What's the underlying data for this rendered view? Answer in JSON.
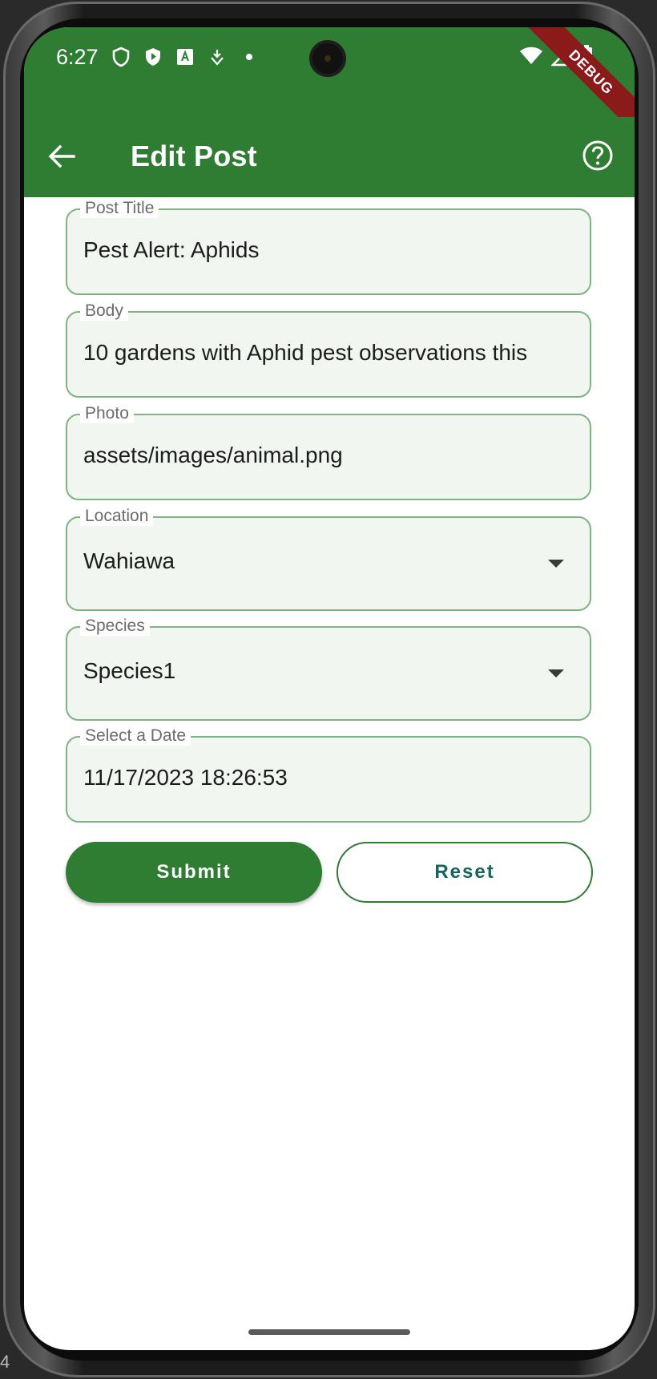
{
  "status_bar": {
    "time": "6:27",
    "icons": [
      "shield-outline-icon",
      "shield-play-icon",
      "font-box-icon",
      "download-shield-icon",
      "dot-icon"
    ],
    "right_icons": [
      "wifi-icon",
      "signal-icon",
      "battery-icon"
    ]
  },
  "debug_banner": "DEBUG",
  "app_bar": {
    "title": "Edit Post",
    "back_icon": "arrow-left-icon",
    "help_icon": "help-circle-icon",
    "color": "#2e7d32"
  },
  "form": {
    "post_title": {
      "label": "Post Title",
      "value": "Pest Alert: Aphids"
    },
    "body": {
      "label": "Body",
      "value": "10 gardens with Aphid pest observations this"
    },
    "photo": {
      "label": "Photo",
      "value": "assets/images/animal.png"
    },
    "location": {
      "label": "Location",
      "value": "Wahiawa"
    },
    "species": {
      "label": "Species",
      "value": "Species1"
    },
    "date": {
      "label": "Select a Date",
      "value": "11/17/2023 18:26:53"
    }
  },
  "buttons": {
    "submit": "Submit",
    "reset": "Reset"
  },
  "colors": {
    "primary": "#2e7d32",
    "field_fill": "#f1f6f1",
    "field_border": "#7fb383"
  },
  "edge_text": "4"
}
